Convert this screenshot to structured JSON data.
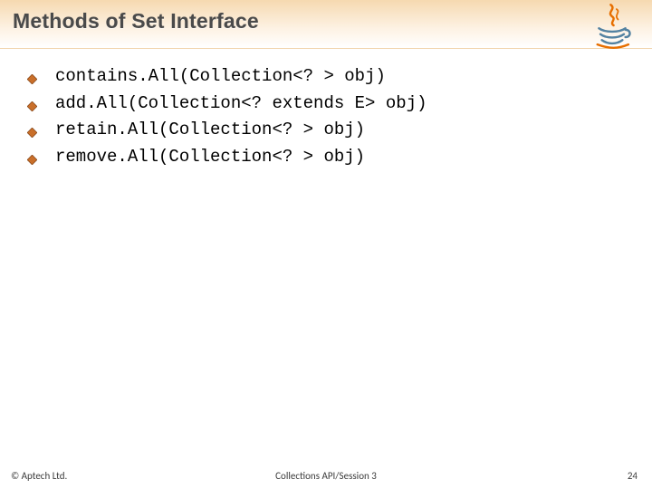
{
  "title": "Methods of Set Interface",
  "logo_alt": "Java logo",
  "bullets": [
    "contains.All(Collection<? > obj)",
    "add.All(Collection<? extends E> obj)",
    "retain.All(Collection<? > obj)",
    "remove.All(Collection<? > obj)"
  ],
  "footer": {
    "copyright": "© Aptech Ltd.",
    "session": "Collections API/Session 3",
    "page": "24"
  }
}
